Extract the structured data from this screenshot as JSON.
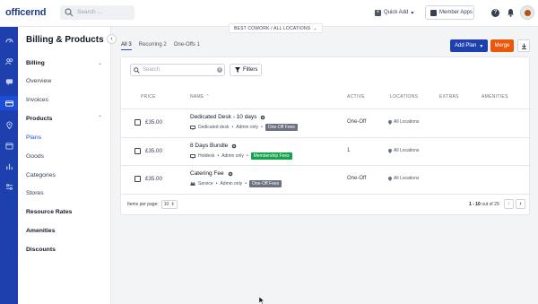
{
  "header": {
    "logo_text": "officernd",
    "search_placeholder": "Search ...",
    "quick_add": "Quick Add",
    "member_apps": "Member Apps",
    "help": "?",
    "location_selector": "BEST COWORK / ALL LOCATIONS"
  },
  "rail": {
    "icons": [
      "dashboard-icon",
      "members-icon",
      "chat-icon",
      "billing-icon",
      "location-icon",
      "calendar-icon",
      "reports-icon",
      "settings-icon"
    ],
    "active": "billing-icon"
  },
  "sidebar": {
    "title": "Billing & Products",
    "items": [
      {
        "label": "Billing",
        "type": "section"
      },
      {
        "label": "Overview",
        "type": "link"
      },
      {
        "label": "Invoices",
        "type": "link"
      },
      {
        "label": "Products",
        "type": "section"
      },
      {
        "label": "Plans",
        "type": "active"
      },
      {
        "label": "Goods",
        "type": "link"
      },
      {
        "label": "Categories",
        "type": "link"
      },
      {
        "label": "Stores",
        "type": "link"
      },
      {
        "label": "Resource Rates",
        "type": "section"
      },
      {
        "label": "Amenities",
        "type": "section"
      },
      {
        "label": "Discounts",
        "type": "section"
      }
    ]
  },
  "tabs": [
    {
      "label": "All 3",
      "active": true
    },
    {
      "label": "Recurring 2",
      "active": false
    },
    {
      "label": "One-Offs 1",
      "active": false
    }
  ],
  "actions": {
    "add_plan": "Add Plan",
    "merge": "Merge"
  },
  "table": {
    "search_placeholder": "Search",
    "filters_label": "Filters",
    "columns": [
      "PRICE",
      "NAME",
      "ACTIVE",
      "LOCATIONS",
      "EXTRAS",
      "AMENITIES"
    ],
    "rows": [
      {
        "price": "£35.00",
        "name": "Dedicated Desk - 10 days",
        "resource": "Dedicated desk",
        "access": "Admin only",
        "tag": "One-Off Fees",
        "tag_color": "#6b7280",
        "active": "One-Off",
        "locations": "All Locations"
      },
      {
        "price": "£35.00",
        "name": "8 Days Bundle",
        "resource": "Hotdesk",
        "access": "Admin only",
        "tag": "Membership Fees",
        "tag_color": "#16a34a",
        "active": "1",
        "locations": "All Locations"
      },
      {
        "price": "£35.00",
        "name": "Catering Fee",
        "resource": "Service",
        "access": "Admin only",
        "tag": "One-Off Fees",
        "tag_color": "#6b7280",
        "active": "One-Off",
        "locations": "All Locations"
      }
    ]
  },
  "pagination": {
    "items_per_page_label": "Items per page:",
    "items_per_page": "10",
    "range": "1 - 10",
    "of_total": "out of 29"
  },
  "colors": {
    "rail": "#1e40af",
    "primary": "#1e40af",
    "merge": "#ea580c",
    "active_link": "#1d4ed8"
  }
}
